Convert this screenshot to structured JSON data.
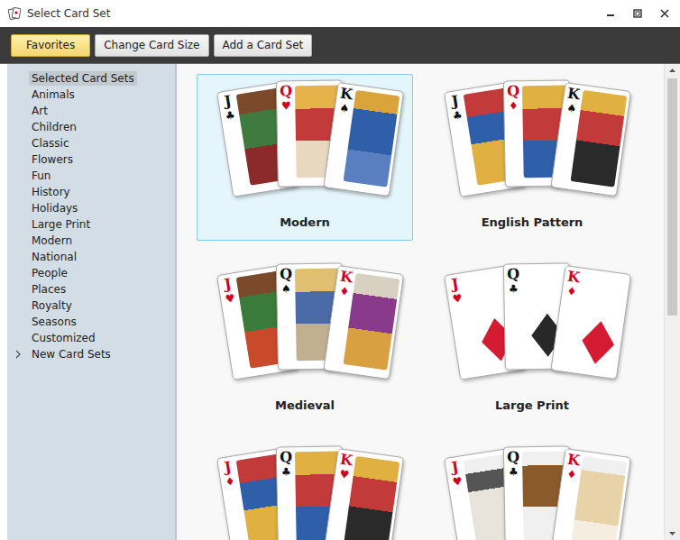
{
  "window": {
    "title": "Select Card Set"
  },
  "toolbar": [
    {
      "label": "Favorites",
      "selected": true
    },
    {
      "label": "Change Card Size",
      "selected": false
    },
    {
      "label": "Add a Card Set",
      "selected": false
    }
  ],
  "sidebar": {
    "items": [
      {
        "label": "Selected Card Sets",
        "selected": true,
        "expandable": false
      },
      {
        "label": "Animals",
        "selected": false,
        "expandable": false
      },
      {
        "label": "Art",
        "selected": false,
        "expandable": false
      },
      {
        "label": "Children",
        "selected": false,
        "expandable": false
      },
      {
        "label": "Classic",
        "selected": false,
        "expandable": false
      },
      {
        "label": "Flowers",
        "selected": false,
        "expandable": false
      },
      {
        "label": "Fun",
        "selected": false,
        "expandable": false
      },
      {
        "label": "History",
        "selected": false,
        "expandable": false
      },
      {
        "label": "Holidays",
        "selected": false,
        "expandable": false
      },
      {
        "label": "Large Print",
        "selected": false,
        "expandable": false
      },
      {
        "label": "Modern",
        "selected": false,
        "expandable": false
      },
      {
        "label": "National",
        "selected": false,
        "expandable": false
      },
      {
        "label": "People",
        "selected": false,
        "expandable": false
      },
      {
        "label": "Places",
        "selected": false,
        "expandable": false
      },
      {
        "label": "Royalty",
        "selected": false,
        "expandable": false
      },
      {
        "label": "Seasons",
        "selected": false,
        "expandable": false
      },
      {
        "label": "Customized",
        "selected": false,
        "expandable": false
      },
      {
        "label": "New Card Sets",
        "selected": false,
        "expandable": true
      }
    ]
  },
  "card_sets": [
    {
      "name": "Modern",
      "selected": true,
      "kind": "figure",
      "cards": [
        {
          "rank": "J",
          "suit": "♣",
          "color": "#111111"
        },
        {
          "rank": "Q",
          "suit": "♥",
          "color": "#d0021b"
        },
        {
          "rank": "K",
          "suit": "♠",
          "color": "#111111"
        }
      ]
    },
    {
      "name": "English Pattern",
      "selected": false,
      "kind": "figure",
      "cards": [
        {
          "rank": "J",
          "suit": "♣",
          "color": "#111111"
        },
        {
          "rank": "Q",
          "suit": "♦",
          "color": "#d0021b"
        },
        {
          "rank": "K",
          "suit": "♠",
          "color": "#111111"
        }
      ]
    },
    {
      "name": "Medieval",
      "selected": false,
      "kind": "figure",
      "cards": [
        {
          "rank": "J",
          "suit": "♥",
          "color": "#d0021b"
        },
        {
          "rank": "Q",
          "suit": "♠",
          "color": "#111111"
        },
        {
          "rank": "K",
          "suit": "♦",
          "color": "#d0021b"
        }
      ]
    },
    {
      "name": "Large Print",
      "selected": false,
      "kind": "large",
      "cards": [
        {
          "rank": "J",
          "suit": "♥",
          "color": "#d0021b"
        },
        {
          "rank": "Q",
          "suit": "♣",
          "color": "#111111"
        },
        {
          "rank": "K",
          "suit": "♦",
          "color": "#d0021b"
        }
      ]
    },
    {
      "selected": false,
      "kind": "figure",
      "cards": [
        {
          "rank": "J",
          "suit": "♦",
          "color": "#d0021b"
        },
        {
          "rank": "Q",
          "suit": "♣",
          "color": "#111111"
        },
        {
          "rank": "K",
          "suit": "♥",
          "color": "#d0021b"
        }
      ]
    },
    {
      "selected": false,
      "kind": "photo",
      "cards": [
        {
          "rank": "J",
          "suit": "♥",
          "color": "#d0021b"
        },
        {
          "rank": "Q",
          "suit": "♣",
          "color": "#111111"
        },
        {
          "rank": "K",
          "suit": "♦",
          "color": "#d0021b"
        }
      ]
    }
  ],
  "scrollbar": {
    "level": 0.53
  }
}
